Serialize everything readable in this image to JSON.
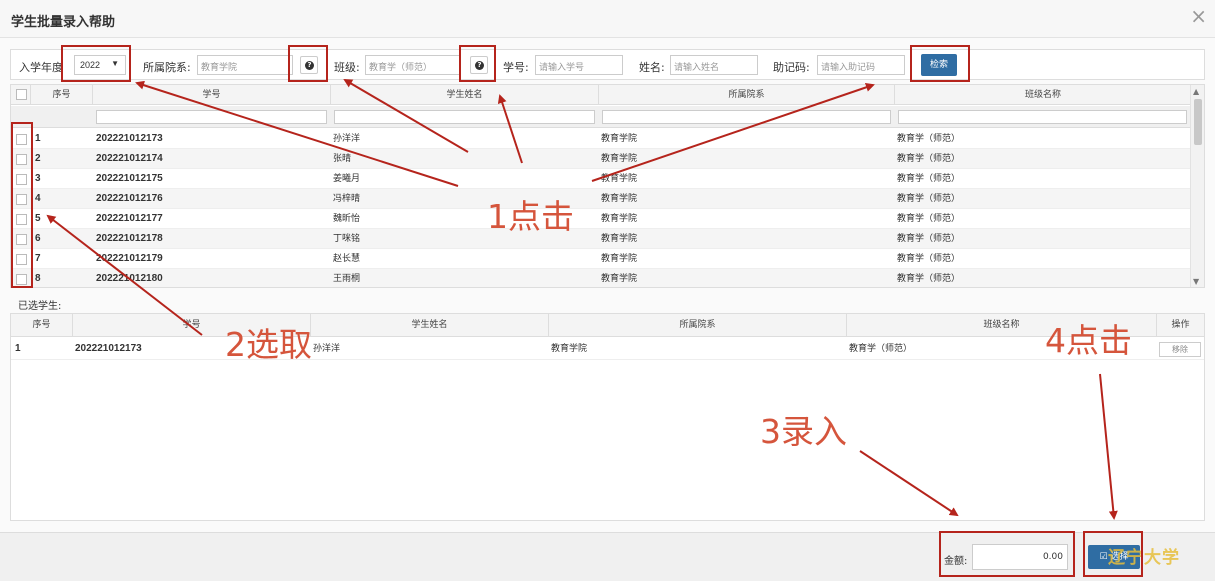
{
  "dialog": {
    "title": "学生批量录入帮助",
    "close_icon": "×"
  },
  "filters": {
    "year_label": "入学年度",
    "year_value": "2022",
    "college_label": "所属院系:",
    "college_value": "教育学院",
    "class_label": "班级:",
    "class_value": "教育学（师范）",
    "student_no_label": "学号:",
    "student_no_placeholder": "请输入学号",
    "name_label": "姓名:",
    "name_placeholder": "请输入姓名",
    "code_label": "助记码:",
    "code_placeholder": "请输入助记码",
    "help_icon": "?",
    "search_label": "检索"
  },
  "student_table": {
    "columns": [
      "序号",
      "学号",
      "学生姓名",
      "所属院系",
      "班级名称"
    ],
    "rows": [
      {
        "seq": "1",
        "id": "202221012173",
        "name": "孙洋洋",
        "college": "教育学院",
        "class": "教育学（师范）"
      },
      {
        "seq": "2",
        "id": "202221012174",
        "name": "张晴",
        "college": "教育学院",
        "class": "教育学（师范）"
      },
      {
        "seq": "3",
        "id": "202221012175",
        "name": "姜曦月",
        "college": "教育学院",
        "class": "教育学（师范）"
      },
      {
        "seq": "4",
        "id": "202221012176",
        "name": "冯梓晴",
        "college": "教育学院",
        "class": "教育学（师范）"
      },
      {
        "seq": "5",
        "id": "202221012177",
        "name": "魏昕怡",
        "college": "教育学院",
        "class": "教育学（师范）"
      },
      {
        "seq": "6",
        "id": "202221012178",
        "name": "丁咪铭",
        "college": "教育学院",
        "class": "教育学（师范）"
      },
      {
        "seq": "7",
        "id": "202221012179",
        "name": "赵长慧",
        "college": "教育学院",
        "class": "教育学（师范）"
      },
      {
        "seq": "8",
        "id": "202221012180",
        "name": "王雨桐",
        "college": "教育学院",
        "class": "教育学（师范）"
      }
    ]
  },
  "selected": {
    "label": "已选学生:",
    "columns": [
      "序号",
      "学号",
      "学生姓名",
      "所属院系",
      "班级名称",
      "操作"
    ],
    "rows": [
      {
        "seq": "1",
        "id": "202221012173",
        "name": "孙洋洋",
        "college": "教育学院",
        "class": "教育学（师范）",
        "action": "移除"
      }
    ]
  },
  "footer": {
    "amount_label": "金额:",
    "amount_value": "0.00",
    "confirm_label": "☑ 选择",
    "watermark": "辽宁大学"
  },
  "annotations": {
    "step1": "1点击",
    "step2": "2选取",
    "step3": "3录入",
    "step4": "4点击",
    "color": "#b5241c"
  }
}
